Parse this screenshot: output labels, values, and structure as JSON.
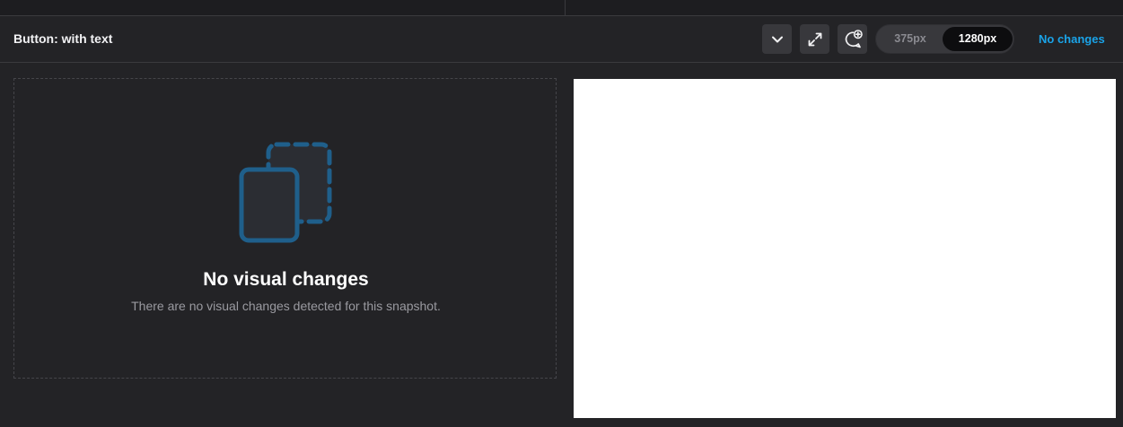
{
  "header": {
    "title": "Button: with text",
    "icons": [
      "chevron-down-icon",
      "expand-icon",
      "add-comment-icon"
    ],
    "viewport_options": [
      {
        "label": "375px",
        "selected": false
      },
      {
        "label": "1280px",
        "selected": true
      }
    ],
    "status_link": "No changes"
  },
  "empty_state": {
    "icon": "snapshot-overlap-icon",
    "title": "No visual changes",
    "description": "There are no visual changes detected for this snapshot."
  },
  "colors": {
    "background": "#232326",
    "accent": "#1aa3e8",
    "icon_blue": "#1f5f8b",
    "preview_bg": "#ffffff"
  }
}
